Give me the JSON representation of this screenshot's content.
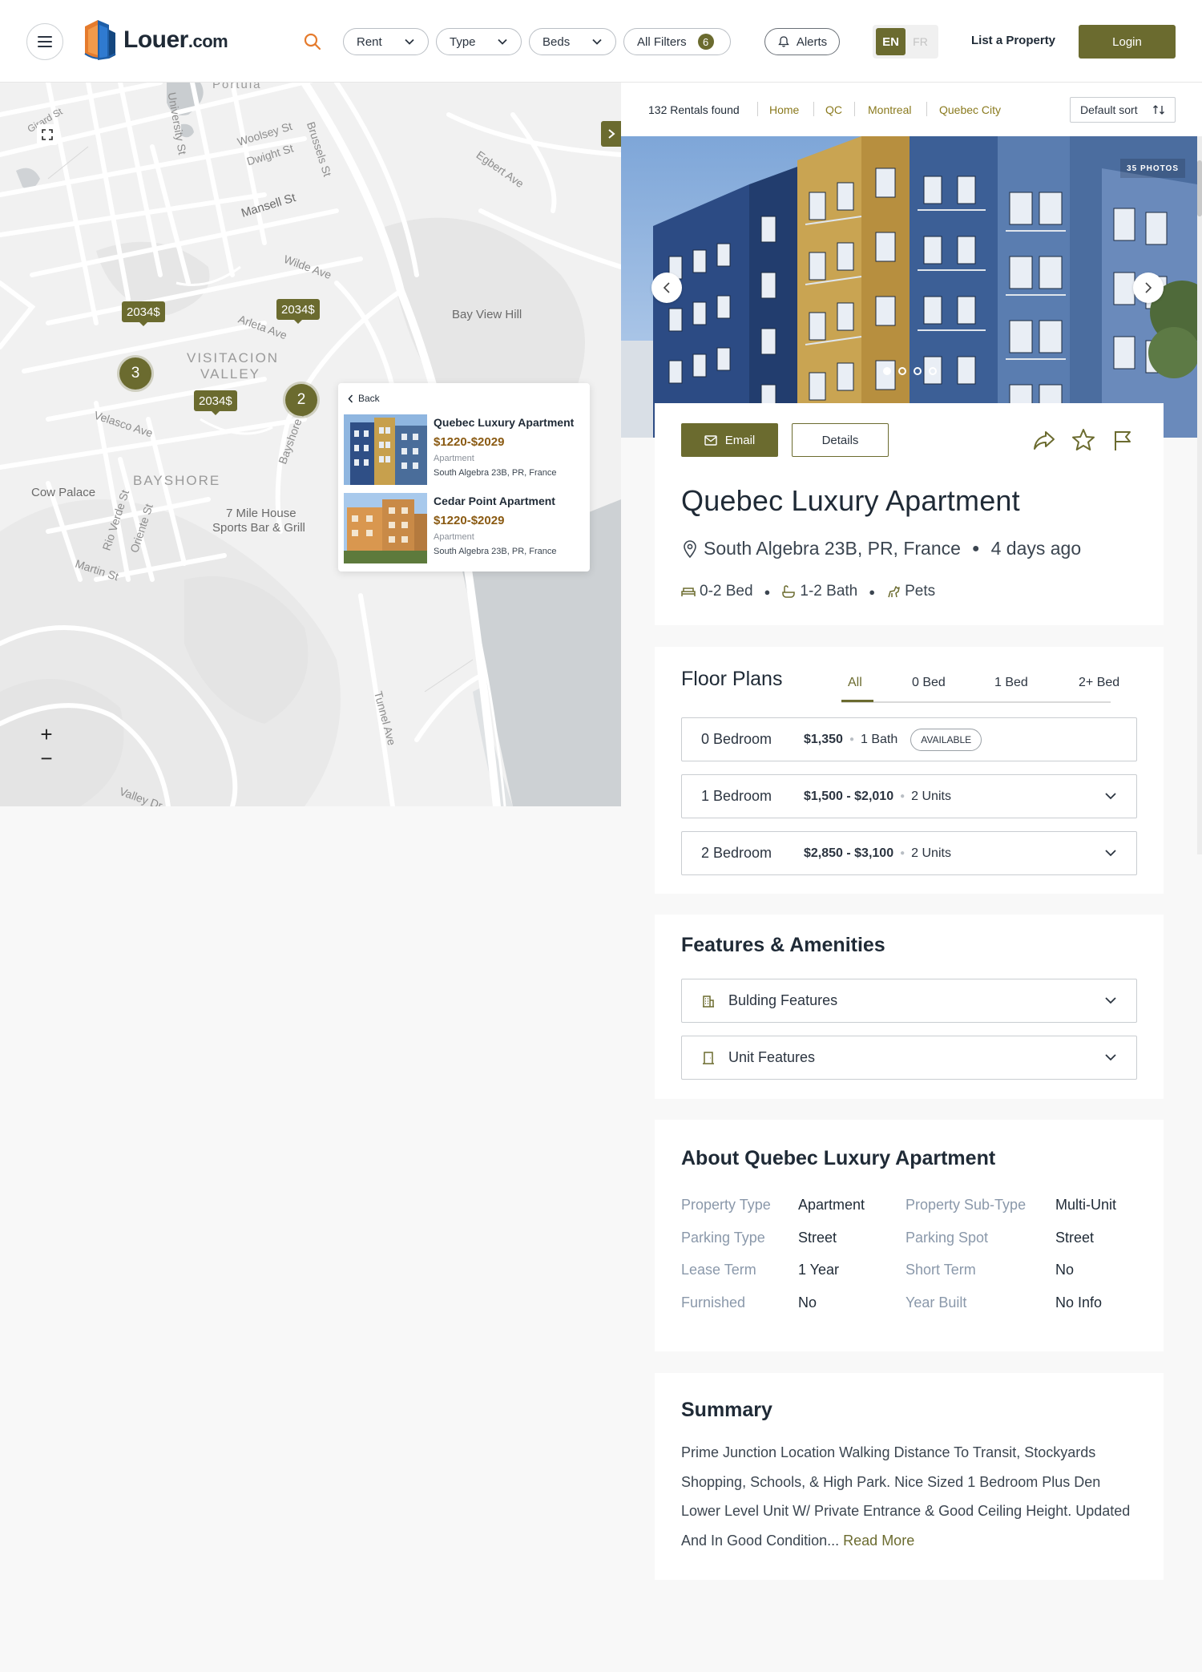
{
  "header": {
    "logo_text": "Louer",
    "logo_suffix": ".com",
    "filters": [
      {
        "label": "Rent"
      },
      {
        "label": "Type"
      },
      {
        "label": "Beds"
      }
    ],
    "all_filters_label": "All Filters",
    "all_filters_count": "6",
    "alerts_label": "Alerts",
    "lang_active": "EN",
    "lang_inactive": "FR",
    "list_property_label": "List a Property",
    "login_label": "Login"
  },
  "map": {
    "streets": [
      "Portula",
      "Woolsey St",
      "Dwight St",
      "Mansell St",
      "Wilde Ave",
      "Arleta Ave",
      "Velasco Ave",
      "Rio Verde St",
      "Oriente St",
      "Martin St",
      "Tunnel Ave",
      "Valley Dr",
      "Egbert Ave",
      "Brussels St",
      "University St",
      "Bayshore Blvd",
      "Girard St"
    ],
    "places": [
      "Bay View Hill",
      "Cow Palace",
      "7 Mile House",
      "Sports Bar & Grill"
    ],
    "districts": [
      "VISITACION",
      "VALLEY",
      "BAYSHORE"
    ],
    "price_tags": [
      "2034$",
      "2034$",
      "2034$"
    ],
    "clusters": [
      "3",
      "2"
    ],
    "zoom_in": "+",
    "zoom_out": "−",
    "popup": {
      "back_label": "Back",
      "items": [
        {
          "title": "Quebec Luxury Apartment",
          "price": "$1220-$2029",
          "type": "Apartment",
          "address": "South Algebra 23B, PR, France"
        },
        {
          "title": "Cedar Point Apartment",
          "price": "$1220-$2029",
          "type": "Apartment",
          "address": "South Algebra 23B, PR, France"
        }
      ]
    }
  },
  "results": {
    "count_label": "132 Rentals found",
    "breadcrumb": [
      "Home",
      "QC",
      "Montreal",
      "Quebec City"
    ],
    "sort_label": "Default sort"
  },
  "gallery": {
    "photos_label": "35 PHOTOS",
    "dots_total": 4,
    "dots_active": 1
  },
  "listing": {
    "email_label": "Email",
    "details_label": "Details",
    "title": "Quebec Luxury Apartment",
    "address": "South Algebra 23B, PR, France",
    "posted": "4 days ago",
    "beds": "0-2 Bed",
    "baths": "1-2 Bath",
    "pets": "Pets"
  },
  "floor_plans": {
    "title": "Floor Plans",
    "tabs": [
      "All",
      "0 Bed",
      "1 Bed",
      "2+ Bed"
    ],
    "rows": [
      {
        "beds": "0 Bedroom",
        "price": "$1,350",
        "meta": "1 Bath",
        "badge": "AVAILABLE"
      },
      {
        "beds": "1 Bedroom",
        "price": "$1,500 - $2,010",
        "meta": "2 Units"
      },
      {
        "beds": "2 Bedroom",
        "price": "$2,850 - $3,100",
        "meta": "2 Units"
      }
    ]
  },
  "features": {
    "title": "Features & Amenities",
    "rows": [
      "Bulding Features",
      "Unit Features"
    ]
  },
  "about": {
    "title": "About Quebec Luxury Apartment",
    "left": [
      {
        "k": "Property Type",
        "v": "Apartment"
      },
      {
        "k": "Parking Type",
        "v": "Street"
      },
      {
        "k": "Lease Term",
        "v": "1 Year"
      },
      {
        "k": "Furnished",
        "v": "No"
      }
    ],
    "right": [
      {
        "k": "Property Sub-Type",
        "v": "Multi-Unit"
      },
      {
        "k": "Parking Spot",
        "v": "Street"
      },
      {
        "k": "Short Term",
        "v": "No"
      },
      {
        "k": "Year Built",
        "v": "No Info"
      }
    ]
  },
  "summary": {
    "title": "Summary",
    "text": "Prime Junction Location Walking Distance To Transit, Stockyards Shopping, Schools, & High Park. Nice Sized 1 Bedroom Plus Den Lower Level Unit W/ Private Entrance & Good Ceiling Height. Updated And In Good Condition...",
    "read_more": "Read More"
  },
  "colors": {
    "accent": "#6b6b2f",
    "price": "#8a5a12",
    "breadcrumb": "#8a7a1e",
    "label_muted": "#8a98aa"
  }
}
